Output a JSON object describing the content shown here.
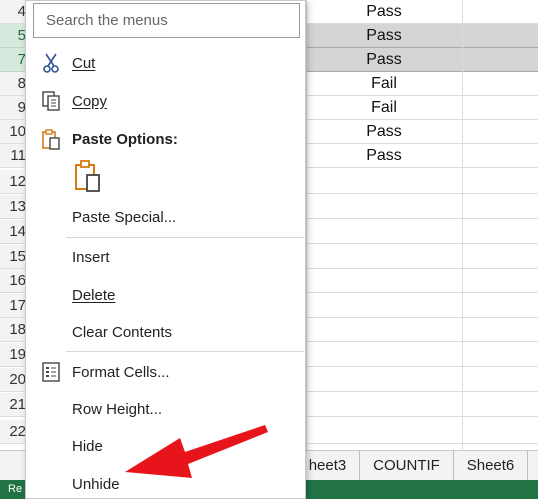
{
  "sheet": {
    "rows": [
      {
        "number": "4",
        "value": "Pass",
        "selected": false
      },
      {
        "number": "5",
        "value": "Pass",
        "selected": true
      },
      {
        "number": "7",
        "value": "Pass",
        "selected": true
      },
      {
        "number": "8",
        "value": "Fail",
        "selected": false
      },
      {
        "number": "9",
        "value": "Fail",
        "selected": false
      },
      {
        "number": "10",
        "value": "Pass",
        "selected": false
      },
      {
        "number": "11",
        "value": "Pass",
        "selected": false
      },
      {
        "number": "12",
        "value": "",
        "selected": false
      },
      {
        "number": "13",
        "value": "",
        "selected": false
      },
      {
        "number": "14",
        "value": "",
        "selected": false
      },
      {
        "number": "15",
        "value": "",
        "selected": false
      },
      {
        "number": "16",
        "value": "",
        "selected": false
      },
      {
        "number": "17",
        "value": "",
        "selected": false
      },
      {
        "number": "18",
        "value": "",
        "selected": false
      },
      {
        "number": "19",
        "value": "",
        "selected": false
      },
      {
        "number": "20",
        "value": "",
        "selected": false
      },
      {
        "number": "21",
        "value": "",
        "selected": false
      },
      {
        "number": "22",
        "value": "",
        "selected": false
      }
    ],
    "tabs": [
      "heet3",
      "COUNTIF",
      "Sheet6"
    ],
    "status": "Re"
  },
  "menu": {
    "search_placeholder": "Search the menus",
    "cut": "Cut",
    "copy": "Copy",
    "paste_options": "Paste Options:",
    "paste_special": "Paste Special...",
    "insert": "Insert",
    "delete": "Delete",
    "clear_contents": "Clear Contents",
    "format_cells": "Format Cells...",
    "row_height": "Row Height...",
    "hide": "Hide",
    "unhide": "Unhide"
  },
  "colors": {
    "accent_green": "#217346",
    "arrow_red": "#e8141b",
    "icon_orange": "#d57b12"
  },
  "icons": [
    "scissors-icon",
    "copy-icon",
    "paste-options-icon",
    "paste-clipboard-icon",
    "format-cells-icon"
  ]
}
